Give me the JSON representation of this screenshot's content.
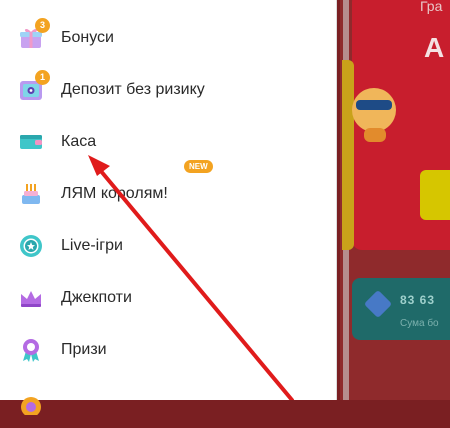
{
  "menu": {
    "items": [
      {
        "id": "bonuses",
        "label": "Бонуси",
        "badge": "3",
        "icon": "gift-icon"
      },
      {
        "id": "deposit-no-risk",
        "label": "Депозит без ризику",
        "badge": "1",
        "icon": "safe-icon"
      },
      {
        "id": "cashier",
        "label": "Каса",
        "icon": "wallet-icon"
      },
      {
        "id": "lyam-korolyam",
        "label": "ЛЯМ королям!",
        "new_badge": "NEW",
        "icon": "cake-icon"
      },
      {
        "id": "live-games",
        "label": "Live-ігри",
        "icon": "live-chip-icon"
      },
      {
        "id": "jackpots",
        "label": "Джекпоти",
        "icon": "crown-icon"
      },
      {
        "id": "prizes",
        "label": "Призи",
        "icon": "award-ribbon-icon"
      }
    ]
  },
  "background": {
    "header_text": "Гра",
    "big_text": "А",
    "info_number": "83 63",
    "info_sub": "Сума бо"
  },
  "colors": {
    "badge": "#f3a321",
    "arrow": "#e01b1b"
  }
}
